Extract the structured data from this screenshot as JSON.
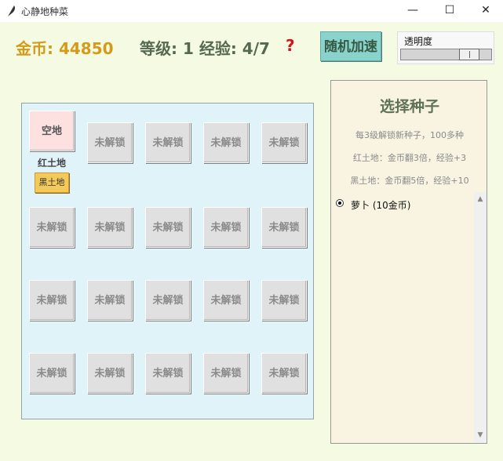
{
  "window": {
    "title": "心静地种菜",
    "minimize": "—",
    "maximize": "☐",
    "close": "✕"
  },
  "header": {
    "gold": "金币: 44850",
    "level_exp": "等级: 1 经验: 4/7",
    "help": "?",
    "speed_button": "随机加速",
    "opacity_label": "透明度",
    "opacity_value": 0.83
  },
  "farm": {
    "plots": [
      "空地",
      "未解锁",
      "未解锁",
      "未解锁",
      "未解锁",
      "未解锁",
      "未解锁",
      "未解锁",
      "未解锁",
      "未解锁",
      "未解锁",
      "未解锁",
      "未解锁",
      "未解锁",
      "未解锁",
      "未解锁",
      "未解锁",
      "未解锁",
      "未解锁",
      "未解锁"
    ],
    "soil_label": "红土地",
    "soil_button": "黑土地"
  },
  "seed_panel": {
    "title": "选择种子",
    "notes": [
      "每3级解锁新种子，100多种",
      "红土地：金币翻3倍，经验+3",
      "黑土地：金币翻5倍，经验+10"
    ],
    "seeds": [
      "萝卜 (10金币)"
    ],
    "scroll_up": "▲",
    "scroll_down": "▼"
  }
}
